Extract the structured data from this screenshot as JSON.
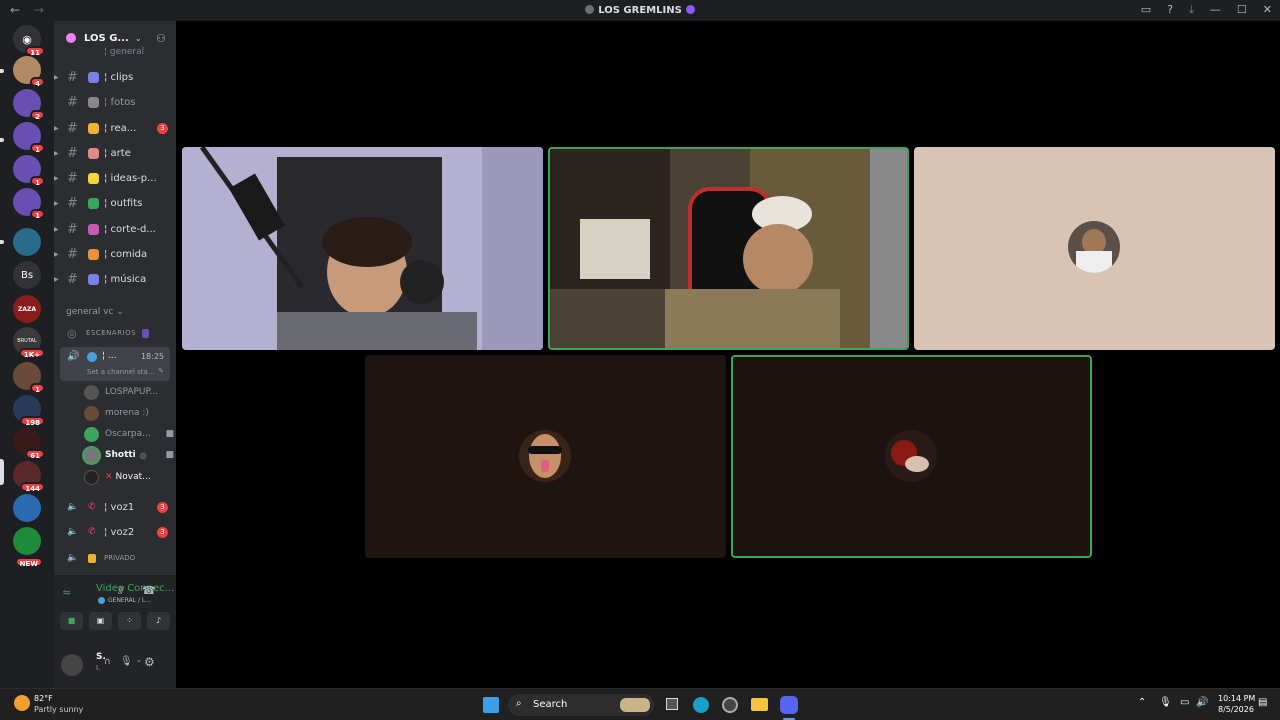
{
  "window": {
    "title": "LOS GREMLINS",
    "back_arrow": "←",
    "forward_arrow": "→"
  },
  "guilds": [
    {
      "icon": "discord-icon",
      "badge": "11"
    },
    {
      "icon": "avatar",
      "badge": "4"
    },
    {
      "icon": "server-icon",
      "badge": "2"
    },
    {
      "icon": "server-icon",
      "badge": "1"
    },
    {
      "icon": "server-icon",
      "badge": "1"
    },
    {
      "icon": "server-icon",
      "badge": "1"
    },
    {
      "icon": "server-icon",
      "label": ""
    },
    {
      "icon": "server-text",
      "label": "Bs"
    },
    {
      "icon": "server-icon",
      "label": "ZAZA"
    },
    {
      "icon": "server-icon",
      "label": "BRUTAL",
      "badge": "1K+"
    },
    {
      "icon": "server-icon",
      "badge": "1"
    },
    {
      "icon": "server-icon",
      "badge": "198"
    },
    {
      "icon": "server-icon",
      "badge": "61"
    },
    {
      "icon": "server-icon",
      "badge": "144"
    },
    {
      "icon": "server-icon",
      "badge": ""
    },
    {
      "icon": "server-icon",
      "badge": "NEW"
    }
  ],
  "server": {
    "name": "LOS G...",
    "partial_top": "¦ general"
  },
  "channels": [
    {
      "name": "¦ clips",
      "badge": "",
      "muted": false
    },
    {
      "name": "¦ fotos",
      "badge": "",
      "muted": true
    },
    {
      "name": "¦ rea...",
      "badge": "3",
      "muted": false
    },
    {
      "name": "¦ arte",
      "badge": "",
      "muted": false
    },
    {
      "name": "¦ ideas-p...",
      "badge": "",
      "muted": false
    },
    {
      "name": "¦ outfits",
      "badge": "",
      "muted": false
    },
    {
      "name": "¦ corte-d...",
      "badge": "",
      "muted": false
    },
    {
      "name": "¦ comida",
      "badge": "",
      "muted": false
    },
    {
      "name": "¦ música",
      "badge": "",
      "muted": false
    }
  ],
  "voice_category": "general vc",
  "stage_channel": "ESCENARIOS",
  "active_vc": {
    "name": "¦ ...",
    "time": "18:25",
    "status": "Set a channel sta..."
  },
  "vc_users": [
    "LOSPAPUP...",
    "morena :)",
    "Oscarpa...",
    "Shotti",
    "Novat..."
  ],
  "voice_channels": [
    {
      "name": "¦ voz1",
      "badge": "3"
    },
    {
      "name": "¦ voz2",
      "badge": "3"
    },
    {
      "name": "PRIVADO",
      "badge": ""
    }
  ],
  "voice_panel": {
    "title": "Video Connec...",
    "subtitle": "GENERAL / L..."
  },
  "user_panel": {
    "name": "S.",
    "sub": "I."
  },
  "taskbar": {
    "temp": "82°F",
    "weather": "Partly sunny",
    "search": "Search",
    "time": "10:14 PM",
    "date": "8/5/2026"
  },
  "colors": {
    "speaking": "#3ba55c",
    "accent": "#5865f2",
    "danger": "#f23f43"
  }
}
